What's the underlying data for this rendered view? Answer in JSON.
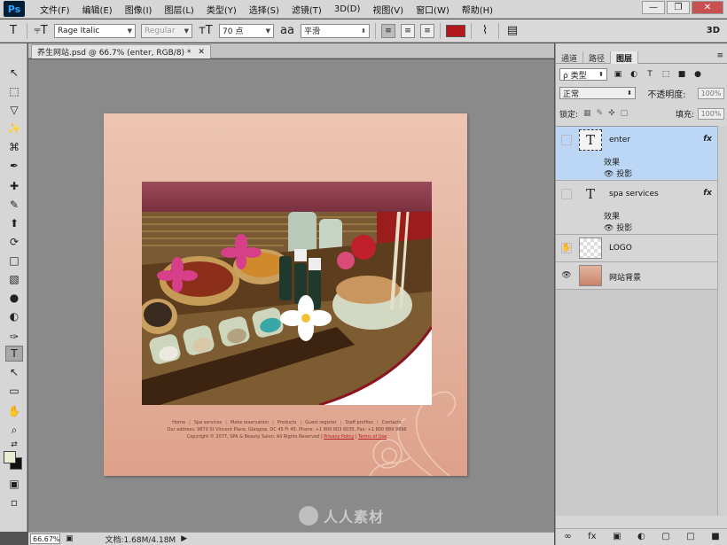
{
  "app": {
    "logo": "Ps",
    "menu": [
      "文件(F)",
      "编辑(E)",
      "图像(I)",
      "图层(L)",
      "类型(Y)",
      "选择(S)",
      "滤镜(T)",
      "3D(D)",
      "视图(V)",
      "窗口(W)",
      "帮助(H)"
    ],
    "window_controls": [
      "—",
      "❐",
      "✕"
    ]
  },
  "options": {
    "tool_glyph": "T",
    "orient_glyph": "⫧T",
    "font_family": "Rage Italic",
    "font_style": "Regular",
    "font_size": "70 点",
    "aa_label": "aa",
    "aa_mode": "平滑",
    "text_color": "#b3181c",
    "label_3d": "3D"
  },
  "toolbar": {
    "icons": [
      "↖",
      "⬚",
      "▽",
      "✨",
      "⌘",
      "✒",
      "✚",
      "✎",
      "⬆",
      "⟳",
      "□",
      "▧",
      "●",
      "◐",
      "✑",
      "T",
      "↖",
      "▭",
      "✋",
      "⌕",
      "⇄",
      "▣",
      "▫"
    ]
  },
  "document": {
    "tab_title": "养生网站.psd @ 66.7% (enter, RGB/8) *",
    "tab_close": "✕",
    "footer_nav": [
      "Home",
      "Spa services",
      "Make reservation",
      "Products",
      "Guest register",
      "Staff profiles",
      "Contacts"
    ],
    "footer_address": "Our address: 9870 St Vincent Place, Glasgow, DC 45 Fr 45.  Phone: +1 800 603 6035, Fax: +1 800 889 9898",
    "footer_copy": "Copyright © 2077, SPA & Beauty Salon. All Rights Reserved",
    "footer_privacy": "Privacy Policy",
    "footer_terms": "Terms of Use",
    "watermark": "人人素材"
  },
  "status": {
    "zoom": "66.67%",
    "doc_size": "文档:1.68M/4.18M",
    "arrow": "▶"
  },
  "panel": {
    "tabs": [
      "通道",
      "路径",
      "图层"
    ],
    "menu_glyph": "≡",
    "kind_label": "ρ 类型",
    "filter_icons": [
      "▣",
      "◐",
      "T",
      "⬚",
      "■",
      "●"
    ],
    "blend_mode": "正常",
    "opacity_label": "不透明度:",
    "opacity_value": "100%",
    "lock_label": "锁定:",
    "lock_icons": [
      "▦",
      "✎",
      "✜",
      "▢"
    ],
    "fill_label": "填充:",
    "fill_value": "100%",
    "layers": [
      {
        "name": "enter",
        "type": "text",
        "effects": "效果",
        "shadow": "投影",
        "fx": "fx",
        "selected": true
      },
      {
        "name": "spa services",
        "type": "text",
        "effects": "效果",
        "shadow": "投影",
        "fx": "fx",
        "selected": false
      },
      {
        "name": "LOGO",
        "type": "empty",
        "selected": false
      },
      {
        "name": "网站背景",
        "type": "image",
        "selected": false
      }
    ],
    "bottom_icons": [
      "∞",
      "fx",
      "▣",
      "◐",
      "▢",
      "□",
      "■"
    ]
  }
}
